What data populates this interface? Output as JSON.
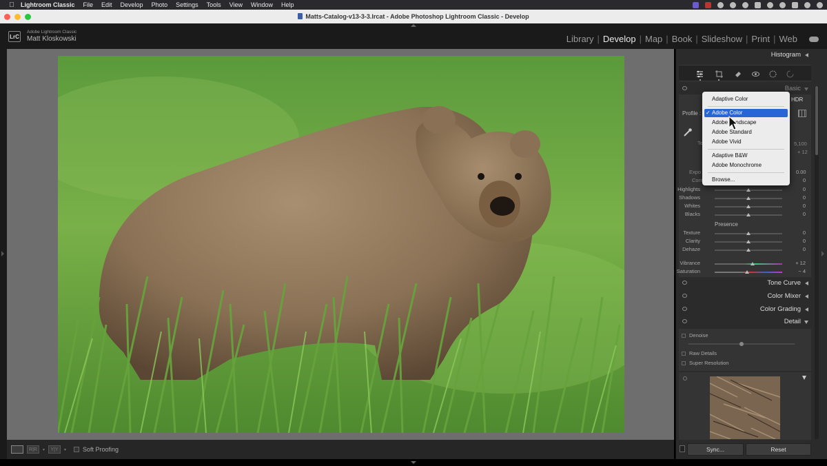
{
  "menubar": {
    "items": [
      "Lightroom Classic",
      "File",
      "Edit",
      "Develop",
      "Photo",
      "Settings",
      "Tools",
      "View",
      "Window",
      "Help"
    ]
  },
  "window": {
    "title": "Matts-Catalog-v13-3-3.lrcat - Adobe Photoshop Lightroom Classic - Develop"
  },
  "identity": {
    "app_name": "Adobe Lightroom Classic",
    "user_name": "Matt Kloskowski",
    "logo": "LrC"
  },
  "modules": [
    "Library",
    "Develop",
    "Map",
    "Book",
    "Slideshow",
    "Print",
    "Web"
  ],
  "active_module": "Develop",
  "toolbar": {
    "compare_label": "R|R",
    "survey_label": "Y|Y",
    "soft_proofing": "Soft Proofing"
  },
  "panels": {
    "histogram": "Histogram",
    "basic": "Basic",
    "tone_curve": "Tone Curve",
    "color_mixer": "Color Mixer",
    "color_grading": "Color Grading",
    "detail": "Detail"
  },
  "basic": {
    "hdr": "HDR",
    "profile_label": "Profile :",
    "wb_temp_value": "5,100",
    "wb_tint_value": "+ 12",
    "exposure_value": "0.00",
    "presence_label": "Presence",
    "sliders": [
      {
        "label": "Highlights",
        "value": "0",
        "level": 0.5
      },
      {
        "label": "Shadows",
        "value": "0",
        "level": 0.5
      },
      {
        "label": "Whites",
        "value": "0",
        "level": 0.5
      },
      {
        "label": "Blacks",
        "value": "0",
        "level": 0.5
      }
    ],
    "presence_sliders": [
      {
        "label": "Texture",
        "value": "0",
        "level": 0.5
      },
      {
        "label": "Clarity",
        "value": "0",
        "level": 0.5
      },
      {
        "label": "Dehaze",
        "value": "0",
        "level": 0.5
      }
    ],
    "vibrance": {
      "label": "Vibrance",
      "value": "+ 12",
      "level": 0.56
    },
    "saturation": {
      "label": "Saturation",
      "value": "− 4",
      "level": 0.48
    },
    "partial_labels": {
      "exposure": "Expo",
      "contrast": "Cont",
      "temp": "Te"
    }
  },
  "profile_menu": {
    "items": [
      {
        "label": "Adaptive Color",
        "selected": false
      },
      {
        "label": "Adobe Color",
        "selected": true
      },
      {
        "label": "Adobe Landscape",
        "selected": false
      },
      {
        "label": "Adobe Standard",
        "selected": false
      },
      {
        "label": "Adobe Vivid",
        "selected": false
      },
      {
        "label": "Adaptive B&W",
        "selected": false
      },
      {
        "label": "Adobe Monochrome",
        "selected": false
      },
      {
        "label": "Browse...",
        "selected": false
      }
    ],
    "check_glyph": "✓"
  },
  "detail": {
    "denoise": "Denoise",
    "raw_details": "Raw Details",
    "super_resolution": "Super Resolution",
    "denoise_level": 0.5
  },
  "buttons": {
    "sync": "Sync...",
    "reset": "Reset"
  },
  "colors": {
    "selection_blue": "#2866d6",
    "panel_bg": "#2b2b2b",
    "canvas_gray": "#6e6e6e"
  }
}
